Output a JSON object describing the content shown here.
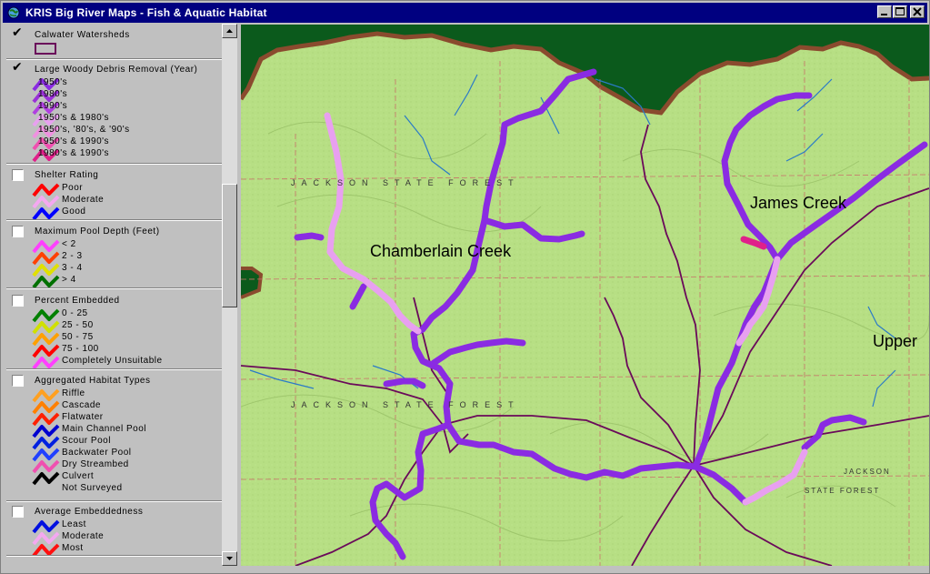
{
  "window": {
    "title": "KRIS Big River Maps - Fish & Aquatic Habitat",
    "titlebar_color": "#000080"
  },
  "legend": {
    "groups": [
      {
        "title": "Calwater Watersheds",
        "checked": true,
        "items": []
      },
      {
        "title": "Large Woody Debris Removal (Year)",
        "checked": true,
        "items": [
          "1950's",
          "1980's",
          "1990's",
          "1950's & 1980's",
          "1950's, '80's, & '90's",
          "1950's & 1990's",
          "1980's & 1990's"
        ]
      },
      {
        "title": "Shelter Rating",
        "checked": false,
        "items": [
          "Poor",
          "Moderate",
          "Good"
        ]
      },
      {
        "title": "Maximum Pool Depth (Feet)",
        "checked": false,
        "items": [
          "< 2",
          "2 - 3",
          "3 - 4",
          "> 4"
        ]
      },
      {
        "title": "Percent Embedded",
        "checked": false,
        "items": [
          "0 - 25",
          "25 - 50",
          "50 - 75",
          "75 - 100",
          "Completely Unsuitable"
        ]
      },
      {
        "title": "Aggregated Habitat Types",
        "checked": false,
        "items": [
          "Riffle",
          "Cascade",
          "Flatwater",
          "Main Channel Pool",
          "Scour Pool",
          "Backwater Pool",
          "Dry Streambed",
          "Culvert",
          "Not Surveyed"
        ]
      },
      {
        "title": "Average Embeddedness",
        "checked": false,
        "items": [
          "Least",
          "Moderate",
          "Most"
        ]
      }
    ]
  },
  "map": {
    "labels": {
      "chamberlain": "Chamberlain Creek",
      "james": "James Creek",
      "upper": "Upper"
    },
    "forest_labels": {
      "jackson_state_forest_north": "JACKSON STATE FOREST",
      "jackson_state_forest_south": "JACKSON STATE FOREST",
      "jackson_east": "JACKSON",
      "state_forest_east": "STATE FOREST"
    },
    "colors": {
      "terrain": "#b7df84",
      "forest_outside": "#0b5a1c",
      "boundary": "#8a4b2e",
      "stream_1950s": "#8a2be2",
      "stream_1950s_1980s": "#e8a0f0",
      "stream_1980s_1990s": "#e0208a",
      "watershed_line": "#6a0a5a",
      "creek_blue": "#2a7ac8"
    }
  }
}
